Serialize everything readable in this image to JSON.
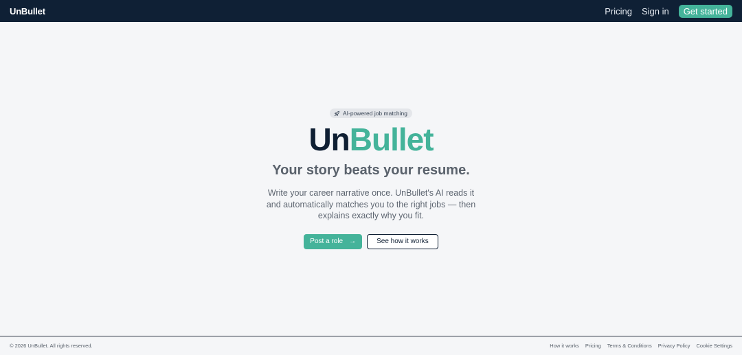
{
  "header": {
    "brand": "UnBullet",
    "nav": {
      "pricing": "Pricing",
      "sign_in": "Sign in",
      "cta": "Get started"
    }
  },
  "hero": {
    "badge": {
      "icon": "rocket-icon",
      "text": "AI-powered job matching"
    },
    "title_part1": "Un",
    "title_part2": "Bullet",
    "subtitle": "Your story beats your resume.",
    "description": "Write your career narrative once. UnBullet's AI reads it and automatically matches you to the right jobs — then explains exactly why you fit.",
    "primary_button": {
      "label": "Post a role",
      "icon": "arrow-right-icon",
      "icon_glyph": "→"
    },
    "secondary_button": {
      "label": "See how it works"
    }
  },
  "footer": {
    "copyright": "© 2026 UnBullet. All rights reserved.",
    "links": [
      "How it works",
      "Pricing",
      "Terms & Conditions",
      "Privacy Policy",
      "Cookie Settings"
    ]
  },
  "colors": {
    "navbar_bg": "#0f2035",
    "accent": "#44b39a",
    "page_bg": "#f5f6f8",
    "text_dark": "#0f1f33"
  }
}
